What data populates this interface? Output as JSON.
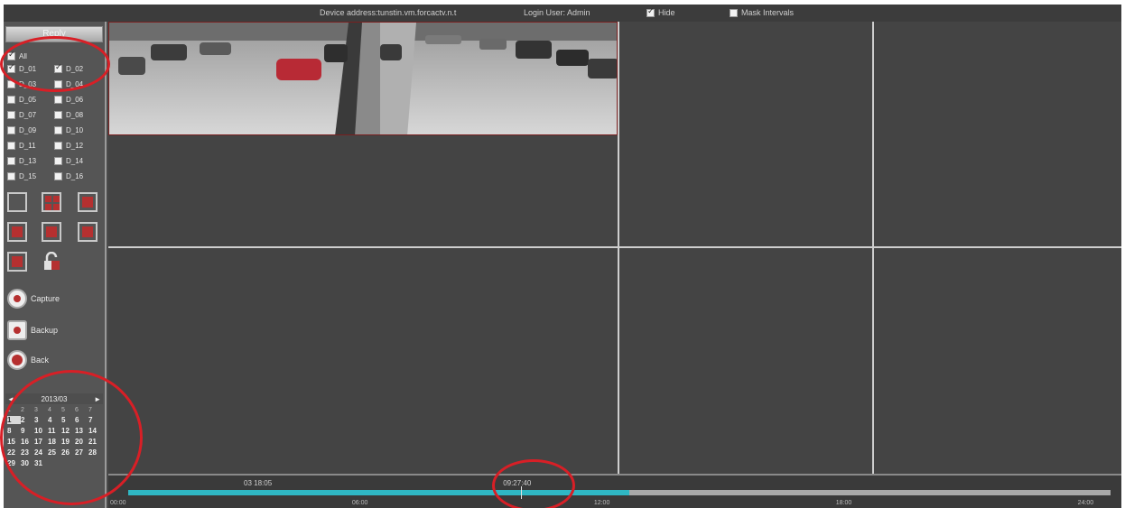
{
  "topbar": {
    "device_info": "Device address:tunstin.vm.forcactv.n.t",
    "user_info": "Login User: Admin",
    "checkboxes": [
      {
        "label": "Hide",
        "checked": true
      },
      {
        "label": "Mask Intervals",
        "checked": false
      }
    ]
  },
  "sidebar": {
    "header": "Reply",
    "channels_all": "All",
    "channels": [
      {
        "label": "D_01",
        "checked": true
      },
      {
        "label": "D_02",
        "checked": true
      },
      {
        "label": "D_03",
        "checked": false
      },
      {
        "label": "D_04",
        "checked": false
      },
      {
        "label": "D_05",
        "checked": false
      },
      {
        "label": "D_06",
        "checked": false
      },
      {
        "label": "D_07",
        "checked": false
      },
      {
        "label": "D_08",
        "checked": false
      },
      {
        "label": "D_09",
        "checked": false
      },
      {
        "label": "D_10",
        "checked": false
      },
      {
        "label": "D_11",
        "checked": false
      },
      {
        "label": "D_12",
        "checked": false
      },
      {
        "label": "D_13",
        "checked": false
      },
      {
        "label": "D_14",
        "checked": false
      },
      {
        "label": "D_15",
        "checked": false
      },
      {
        "label": "D_16",
        "checked": false
      }
    ],
    "actions": {
      "capture": "Capture",
      "backup": "Backup",
      "back": "Back"
    }
  },
  "calendar": {
    "month": "2013/03",
    "prev": "◄",
    "next": "►",
    "dow": [
      "1",
      "2",
      "3",
      "4",
      "5",
      "6",
      "7"
    ],
    "days": [
      "1",
      "2",
      "3",
      "4",
      "5",
      "6",
      "7",
      "8",
      "9",
      "10",
      "11",
      "12",
      "13",
      "14",
      "15",
      "16",
      "17",
      "18",
      "19",
      "20",
      "21",
      "22",
      "23",
      "24",
      "25",
      "26",
      "27",
      "28",
      "29",
      "30",
      "31"
    ],
    "selected": "1"
  },
  "timeline": {
    "range_label": "03 18:05",
    "cursor_time": "09:27:40",
    "progress": 0.51,
    "cursor_position": 0.4,
    "ticks": [
      "00:00",
      "06:00",
      "12:00",
      "18:00",
      "24:00"
    ]
  },
  "colors": {
    "accent_red": "#b53030",
    "timeline_cyan": "#2fb7c4",
    "annotation_red": "#d81f26"
  }
}
